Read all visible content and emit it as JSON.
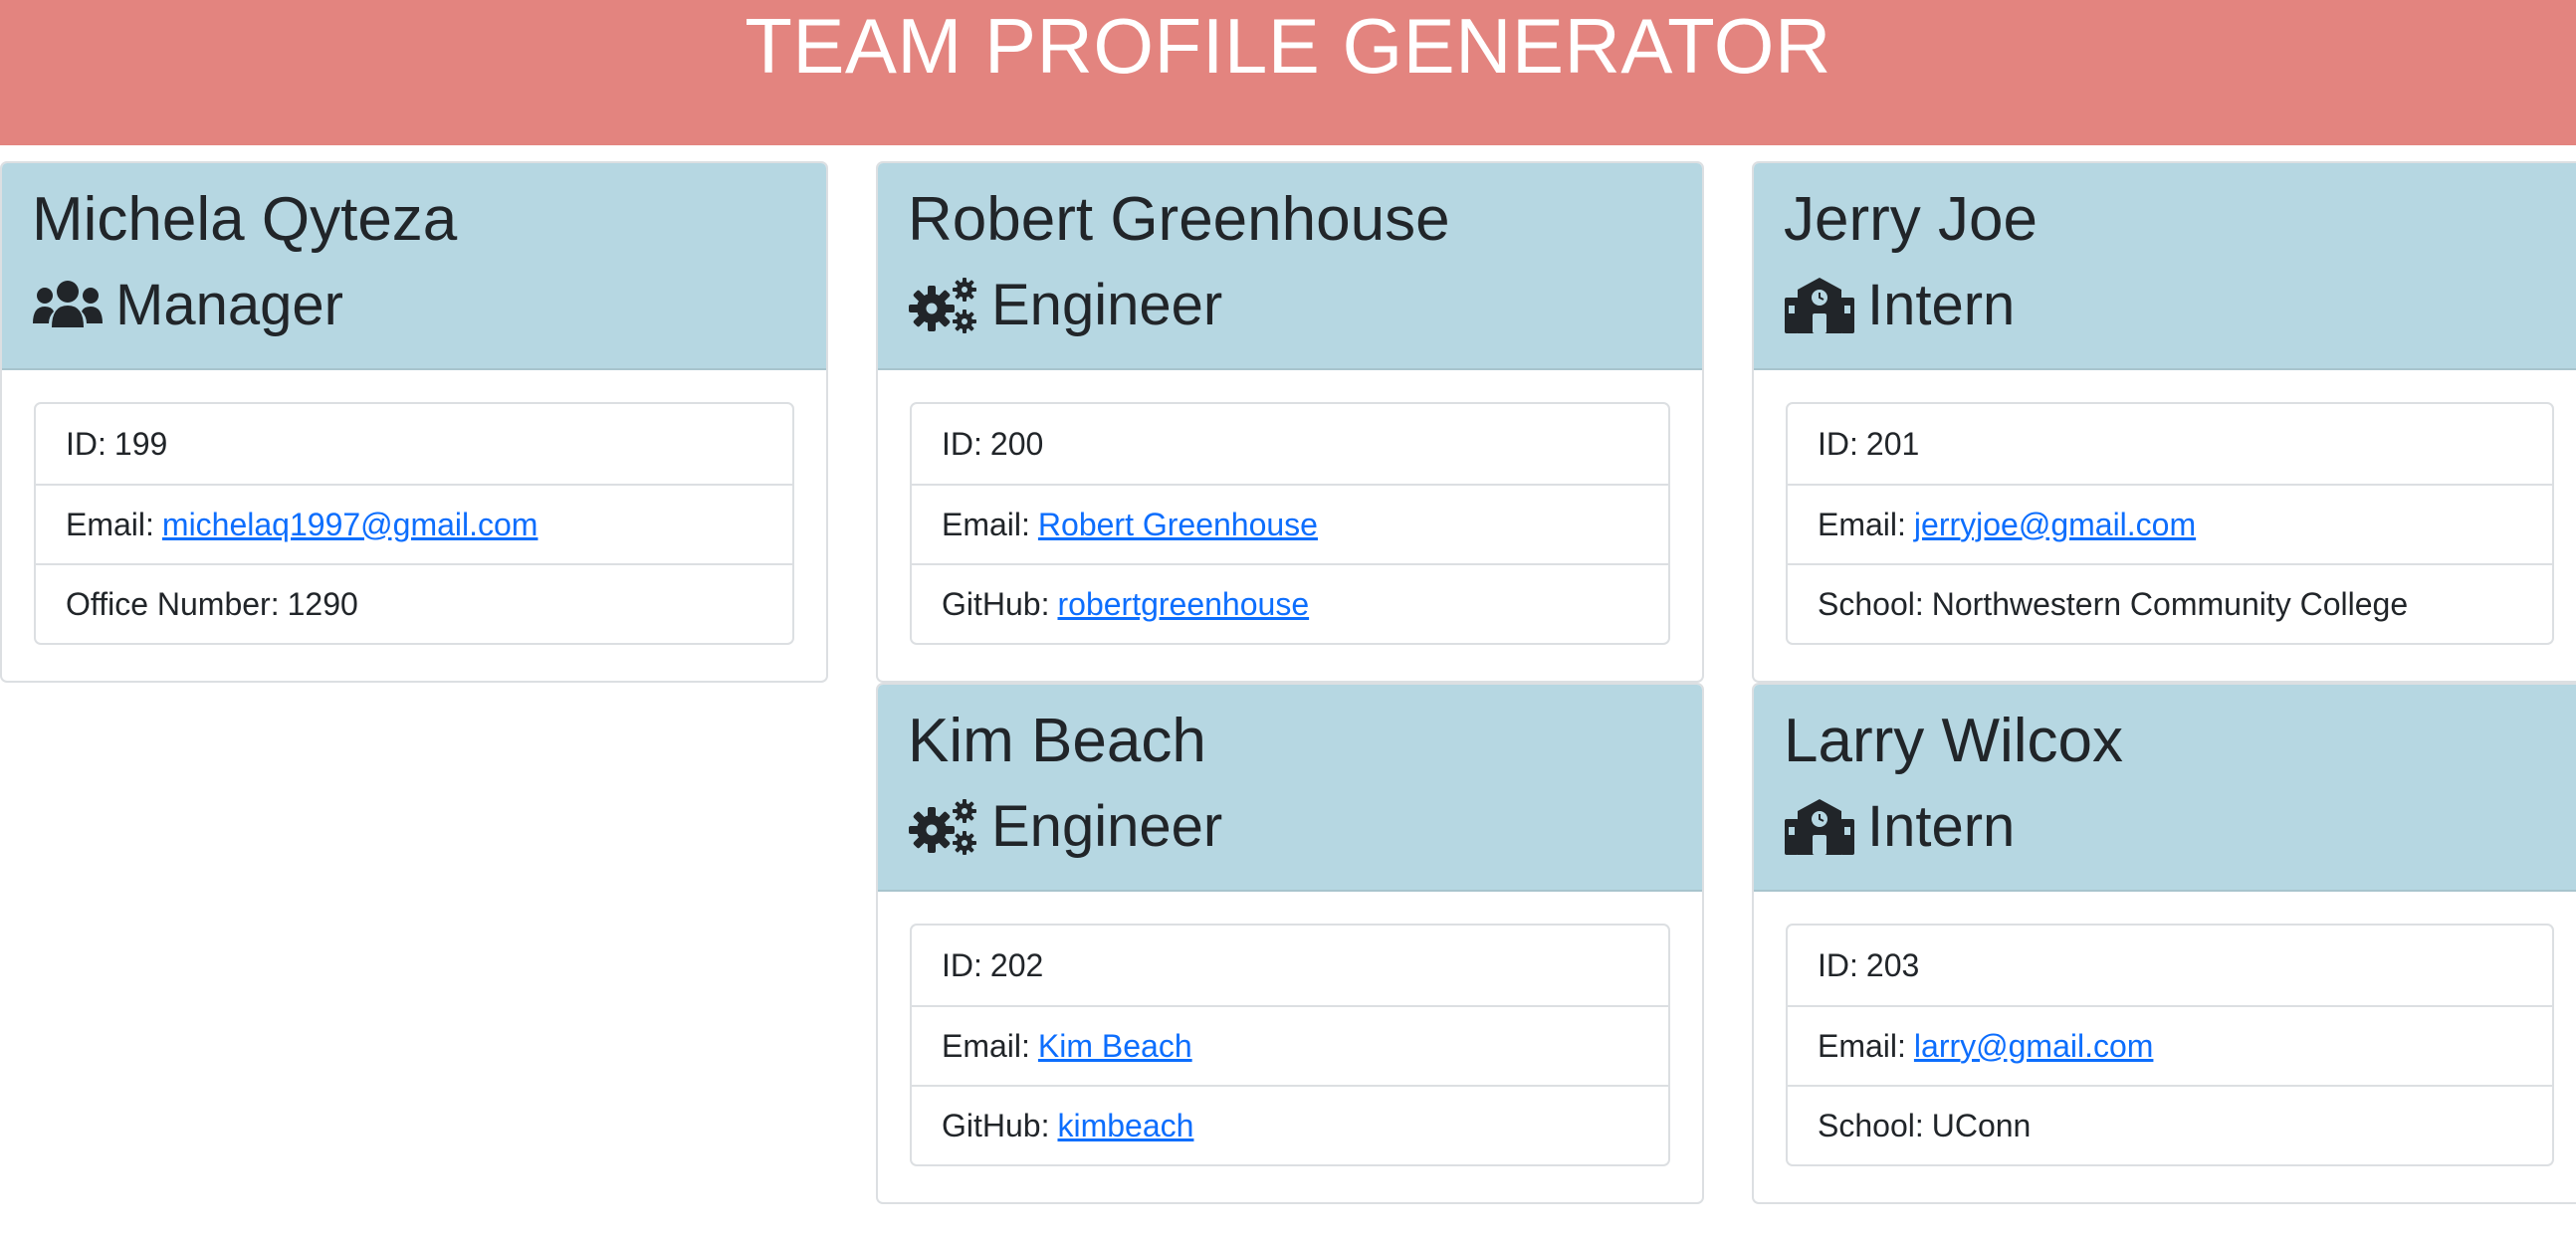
{
  "header": {
    "title": "TEAM PROFILE GENERATOR"
  },
  "colors": {
    "header_bg": "#e3847f",
    "card_header_bg": "#b6d7e2",
    "link": "#0d6efd"
  },
  "cards": [
    {
      "name": "Michela Qyteza",
      "role": "Manager",
      "icon": "users-icon",
      "id_label": "ID:",
      "id": "199",
      "email_label": "Email:",
      "email": "michelaq1997@gmail.com",
      "extra_label": "Office Number:",
      "extra": "1290"
    },
    {
      "name": "Robert Greenhouse",
      "role": "Engineer",
      "icon": "cogs-icon",
      "id_label": "ID:",
      "id": "200",
      "email_label": "Email:",
      "email": "Robert Greenhouse",
      "extra_label": "GitHub:",
      "extra": "robertgreenhouse"
    },
    {
      "name": "Jerry Joe",
      "role": "Intern",
      "icon": "school-icon",
      "id_label": "ID:",
      "id": "201",
      "email_label": "Email:",
      "email": "jerryjoe@gmail.com",
      "extra_label": "School:",
      "extra": "Northwestern Community College"
    },
    {
      "name": "Kim Beach",
      "role": "Engineer",
      "icon": "cogs-icon",
      "id_label": "ID:",
      "id": "202",
      "email_label": "Email:",
      "email": "Kim Beach",
      "extra_label": "GitHub:",
      "extra": "kimbeach"
    },
    {
      "name": "Larry Wilcox",
      "role": "Intern",
      "icon": "school-icon",
      "id_label": "ID:",
      "id": "203",
      "email_label": "Email:",
      "email": "larry@gmail.com",
      "extra_label": "School:",
      "extra": "UConn"
    }
  ]
}
